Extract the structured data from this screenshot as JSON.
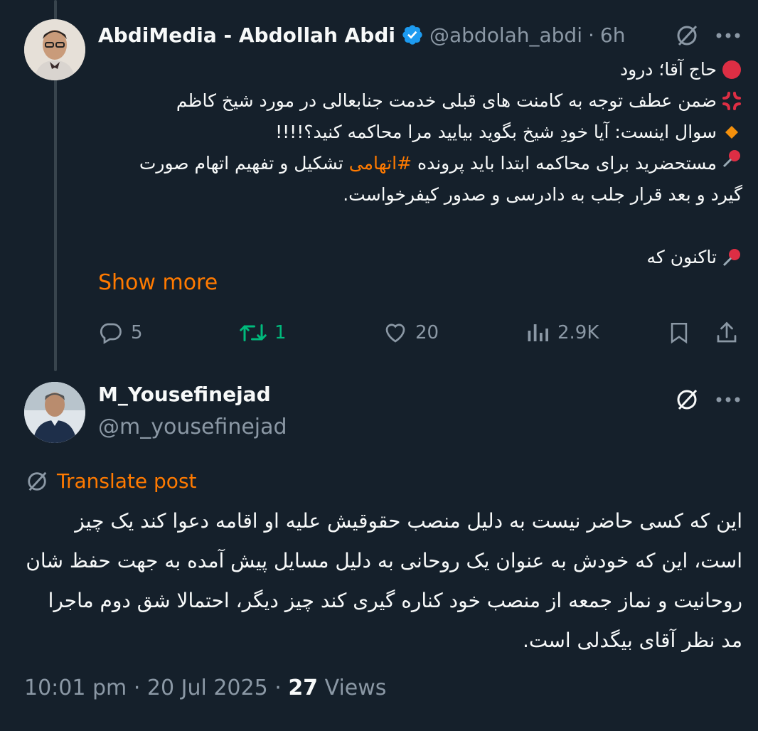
{
  "post1": {
    "author_name": "AbdiMedia - Abdollah Abdi",
    "handle": "@abdolah_abdi",
    "separator": "·",
    "time": "6h",
    "lines": [
      {
        "emoji": "red-circle",
        "text": "حاج آقا؛ درود"
      },
      {
        "emoji": "anger-symbol",
        "text": "ضمن عطف توجه به کامنت های قبلی خدمت جنابعالی در مورد شیخ کاظم"
      },
      {
        "emoji": "orange-diamond",
        "text": "سوال اینست: آیا خودِ شیخ بگوید بیایید مرا محاکمه کنید؟!!!!"
      }
    ],
    "para_pin_pre": "مستحضرید برای محاکمه ابتدا باید پرونده ",
    "hashtag": "#اتهامی",
    "para_pin_post": " تشکیل و تفهیم اتهام صورت گیرد و بعد قرار جلب به دادرسی و صدور کیفرخواست.",
    "last_line": "تاکنون که",
    "show_more": "Show more",
    "stats": {
      "replies": "5",
      "reposts": "1",
      "likes": "20",
      "views": "2.9K"
    }
  },
  "post2": {
    "author_name": "M_Yousefinejad",
    "handle": "@m_yousefinejad",
    "translate_label": "Translate post",
    "body": "این که کسی حاضر نیست به دلیل منصب حقوقیش علیه او اقامه دعوا کند یک چیز است، این که خودش به عنوان یک روحانی به دلیل مسایل پیش آمده به جهت حفظ شان روحانیت و نماز جمعه از منصب خود کناره گیری کند چیز دیگر، احتمالا شق دوم ماجرا مد نظر آقای بیگدلی  است.",
    "time": "10:01 pm",
    "date": "20 Jul 2025",
    "views_count": "27",
    "views_label": "Views"
  },
  "colors": {
    "background": "#15202b",
    "accent": "#ff7a00",
    "verified": "#1d9bf0",
    "repost": "#00ba7c",
    "muted": "#8b98a5"
  }
}
